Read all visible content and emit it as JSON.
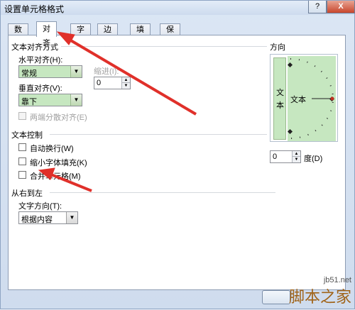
{
  "window": {
    "title": "设置单元格格式",
    "help_label": "?",
    "close_label": "X"
  },
  "tabs": [
    {
      "label": "数字"
    },
    {
      "label": "对齐",
      "active": true
    },
    {
      "label": "字体"
    },
    {
      "label": "边框"
    },
    {
      "label": "填充"
    },
    {
      "label": "保护"
    }
  ],
  "text_alignment": {
    "section_title": "文本对齐方式",
    "horizontal_label": "水平对齐(H):",
    "horizontal_value": "常规",
    "indent_label": "缩进(I):",
    "indent_value": "0",
    "vertical_label": "垂直对齐(V):",
    "vertical_value": "靠下",
    "justify_distributed_label": "两端分散对齐(E)"
  },
  "text_control": {
    "section_title": "文本控制",
    "wrap_label": "自动换行(W)",
    "shrink_label": "缩小字体填充(K)",
    "merge_label": "合并单元格(M)"
  },
  "rtl": {
    "section_title": "从右到左",
    "direction_label": "文字方向(T):",
    "direction_value": "根据内容"
  },
  "orientation": {
    "title": "方向",
    "vertical_text_1": "文",
    "vertical_text_2": "本",
    "dial_text": "文本",
    "degrees_value": "0",
    "degrees_label": "度(D)"
  },
  "watermark": {
    "site": "jb51.net",
    "name": "脚本之家"
  },
  "colors": {
    "accent_green": "#c6e7c0",
    "annotation_red": "#e0302a"
  }
}
